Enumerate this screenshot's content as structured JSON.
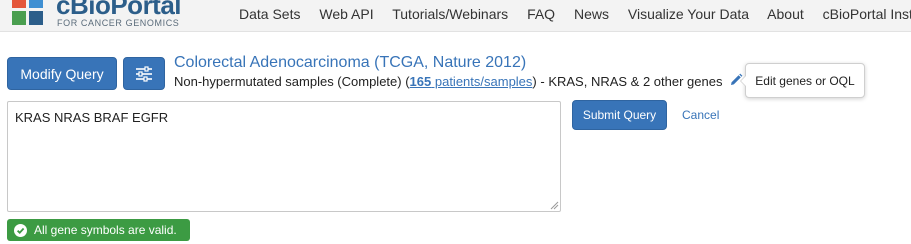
{
  "header": {
    "logo_text": "cBioPortal",
    "logo_subtext": "FOR CANCER GENOMICS",
    "nav": [
      "Data Sets",
      "Web API",
      "Tutorials/Webinars",
      "FAQ",
      "News",
      "Visualize Your Data",
      "About",
      "cBioPortal Installations"
    ]
  },
  "query": {
    "modify_label": "Modify Query",
    "study_title": "Colorectal Adenocarcinoma (TCGA, Nature 2012)",
    "sample_set": "Non-hypermutated samples (Complete) (",
    "sample_count": "165",
    "sample_count_suffix": " patients/samples",
    "sample_set_close": ")",
    "genes_summary": "  - KRAS, NRAS & 2 other genes",
    "edit_tooltip": "Edit genes or OQL",
    "gene_input_value": "KRAS NRAS BRAF EGFR",
    "submit_label": "Submit Query",
    "cancel_label": "Cancel",
    "validation_message": "All gene symbols are valid."
  },
  "colors": {
    "primary_blue": "#3874b8",
    "valid_green": "#3c9b43",
    "header_bg": "#f3f3f3"
  },
  "icons": {
    "settings": "sliders-icon",
    "edit": "pencil-icon",
    "valid": "check-circle-icon"
  }
}
